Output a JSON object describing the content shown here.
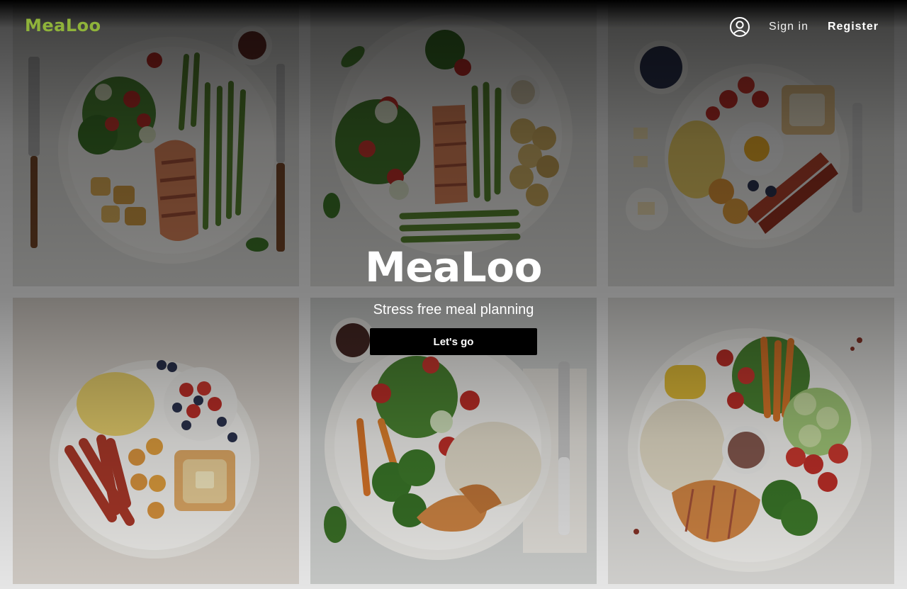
{
  "header": {
    "logo": "MeaLoo",
    "logo_color": "#8fb33a",
    "user_icon": "user-circle-icon",
    "sign_in": "Sign in",
    "register": "Register"
  },
  "hero": {
    "title": "MeaLoo",
    "subtitle": "Stress free meal planning",
    "cta": "Let's go"
  },
  "gallery": [
    {
      "dish": "salmon-asparagus-salad-potatoes"
    },
    {
      "dish": "salmon-asparagus-potatoes-salad"
    },
    {
      "dish": "breakfast-eggs-bacon-toast-berries"
    },
    {
      "dish": "breakfast-eggs-bacon-toast-berries"
    },
    {
      "dish": "chicken-rice-broccoli-salad"
    },
    {
      "dish": "chicken-rice-vegetables"
    }
  ]
}
